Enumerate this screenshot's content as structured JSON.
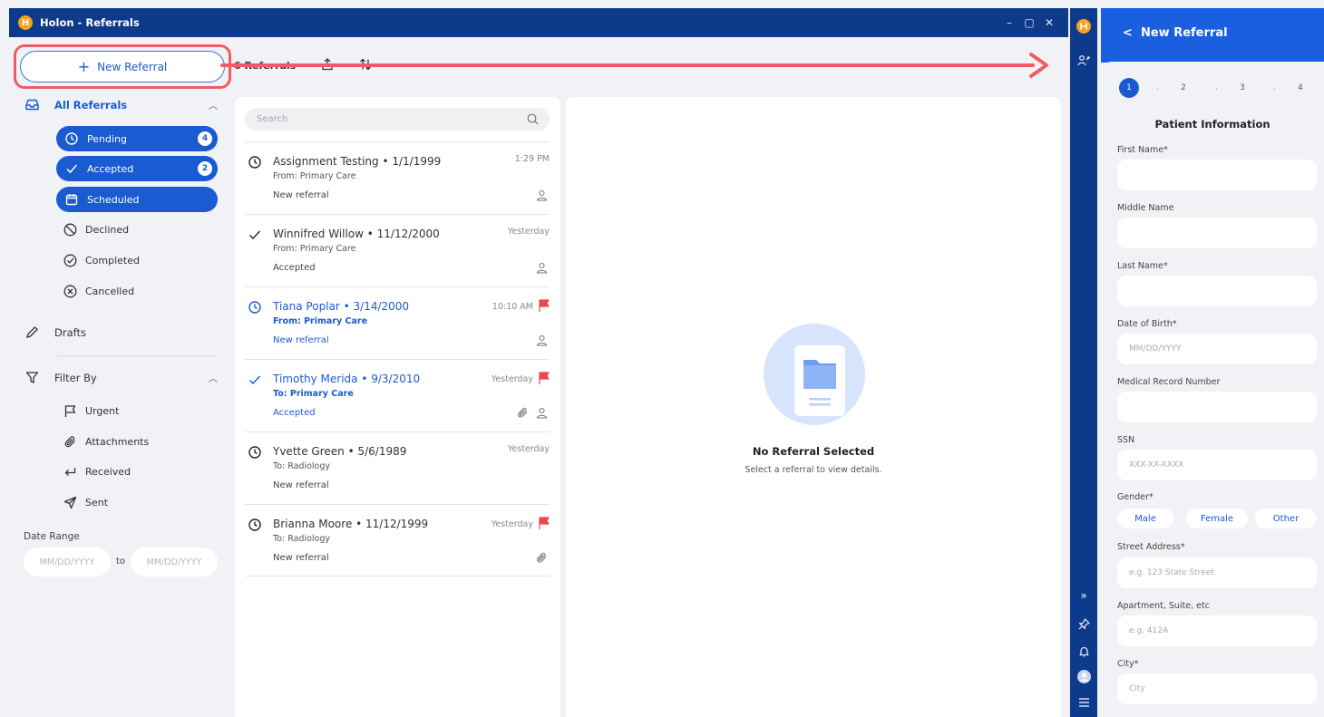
{
  "window": {
    "title": "Holon - Referrals",
    "logo": "H"
  },
  "sidebar": {
    "new_referral_label": "New Referral",
    "all_referrals_label": "All Referrals",
    "statuses": [
      {
        "label": "Pending",
        "count": "4"
      },
      {
        "label": "Accepted",
        "count": "2"
      },
      {
        "label": "Scheduled"
      }
    ],
    "other_statuses": [
      "Declined",
      "Completed",
      "Cancelled"
    ],
    "drafts_label": "Drafts",
    "filter_by_label": "Filter By",
    "filters": [
      "Urgent",
      "Attachments",
      "Received",
      "Sent"
    ],
    "date_range_label": "Date Range",
    "date_from_placeholder": "MM/DD/YYYY",
    "date_to_label": "to",
    "date_to_placeholder": "MM/DD/YYYY"
  },
  "list": {
    "count_label": "6 Referrals",
    "search_placeholder": "Search",
    "rows": [
      {
        "name": "Assignment Testing • 1/1/1999",
        "sub": "From: Primary Care",
        "state": "New referral",
        "time": "1:29 PM",
        "status_icon": "clock-icon"
      },
      {
        "name": "Winnifred Willow • 11/12/2000",
        "sub": "From: Primary Care",
        "state": "Accepted",
        "time": "Yesterday",
        "status_icon": "check-icon"
      },
      {
        "name": "Tiana Poplar • 3/14/2000",
        "sub": "From: Primary Care",
        "state": "New referral",
        "time": "10:10 AM",
        "status_icon": "clock-icon",
        "flag": true
      },
      {
        "name": "Timothy Merida • 9/3/2010",
        "sub": "To: Primary Care",
        "state": "Accepted",
        "time": "Yesterday",
        "status_icon": "check-icon",
        "flag": true
      },
      {
        "name": "Yvette Green • 5/6/1989",
        "sub": "To: Radiology",
        "state": "New referral",
        "time": "Yesterday",
        "status_icon": "clock-icon"
      },
      {
        "name": "Brianna Moore • 11/12/1999",
        "sub": "To: Radiology",
        "state": "New referral",
        "time": "Yesterday",
        "status_icon": "clock-icon",
        "flag": true
      }
    ]
  },
  "detail": {
    "empty_title": "No Referral Selected",
    "empty_sub": "Select a referral to view details."
  },
  "form": {
    "header": "New Referral",
    "steps": [
      "1",
      "2",
      "3",
      "4"
    ],
    "title": "Patient Information",
    "first_name_label": "First Name*",
    "middle_name_label": "Middle Name",
    "last_name_label": "Last Name*",
    "dob_label": "Date of Birth*",
    "dob_placeholder": "MM/DD/YYYY",
    "mrn_label": "Medical Record Number",
    "ssn_label": "SSN",
    "ssn_placeholder": "XXX-XX-XXXX",
    "gender_label": "Gender*",
    "gender_options": [
      "Male",
      "Female",
      "Other"
    ],
    "street_label": "Street Address*",
    "street_placeholder": "e.g. 123 State Street",
    "apt_label": "Apartment, Suite, etc",
    "apt_placeholder": "e.g. 412A",
    "city_label": "City*",
    "city_placeholder": "City"
  },
  "colors": {
    "brand_dark": "#0e3a8c",
    "accent": "#1a5bd1",
    "header_blue": "#1a5fe0",
    "annotation_red": "#ef5d64",
    "flag_red": "#f0474f",
    "logo_orange": "#f7a21b"
  }
}
